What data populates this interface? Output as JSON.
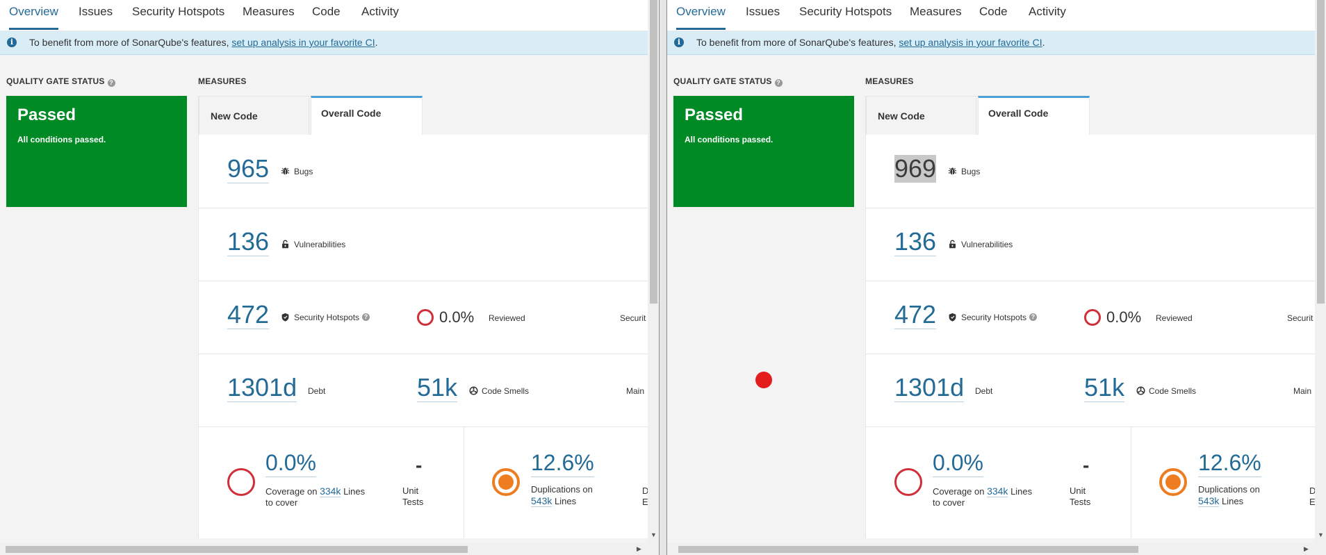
{
  "panes": [
    {
      "nav": [
        "Overview",
        "Issues",
        "Security Hotspots",
        "Measures",
        "Code",
        "Activity"
      ],
      "banner": {
        "prefix": "To benefit from more of SonarQube's features,",
        "link": "set up analysis in your favorite CI",
        "suffix": "."
      },
      "gate": {
        "title": "QUALITY GATE STATUS",
        "status": "Passed",
        "sub": "All conditions passed."
      },
      "measures": {
        "title": "MEASURES",
        "tabs": [
          "New Code",
          "Overall Code"
        ],
        "bugs": {
          "value": "965",
          "label": "Bugs"
        },
        "vulnerabilities": {
          "value": "136",
          "label": "Vulnerabilities"
        },
        "hotspots": {
          "value": "472",
          "label": "Security Hotspots",
          "reviewed_pct": "0.0%",
          "reviewed_label": "Reviewed",
          "edge": "Securit"
        },
        "debt": {
          "value": "1301d",
          "label": "Debt",
          "smells": "51k",
          "smells_label": "Code Smells",
          "edge": "Main"
        },
        "coverage": {
          "value": "0.0%",
          "label_a": "Coverage on",
          "lines": "334k",
          "label_b": "Lines",
          "label_c": "to cover",
          "unit_dash": "-",
          "unit_a": "Unit",
          "unit_b": "Tests"
        },
        "duplications": {
          "value": "12.6%",
          "label_a": "Duplications on",
          "lines": "543k",
          "label_b": "Lines",
          "edge_a": "D",
          "edge_b": "E"
        }
      }
    },
    {
      "nav": [
        "Overview",
        "Issues",
        "Security Hotspots",
        "Measures",
        "Code",
        "Activity"
      ],
      "banner": {
        "prefix": "To benefit from more of SonarQube's features,",
        "link": "set up analysis in your favorite CI",
        "suffix": "."
      },
      "gate": {
        "title": "QUALITY GATE STATUS",
        "status": "Passed",
        "sub": "All conditions passed."
      },
      "measures": {
        "title": "MEASURES",
        "tabs": [
          "New Code",
          "Overall Code"
        ],
        "bugs": {
          "value": "969",
          "label": "Bugs"
        },
        "vulnerabilities": {
          "value": "136",
          "label": "Vulnerabilities"
        },
        "hotspots": {
          "value": "472",
          "label": "Security Hotspots",
          "reviewed_pct": "0.0%",
          "reviewed_label": "Reviewed",
          "edge": "Securit"
        },
        "debt": {
          "value": "1301d",
          "label": "Debt",
          "smells": "51k",
          "smells_label": "Code Smells",
          "edge": "Main"
        },
        "coverage": {
          "value": "0.0%",
          "label_a": "Coverage on",
          "lines": "334k",
          "label_b": "Lines",
          "label_c": "to cover",
          "unit_dash": "-",
          "unit_a": "Unit",
          "unit_b": "Tests"
        },
        "duplications": {
          "value": "12.6%",
          "label_a": "Duplications on",
          "lines": "543k",
          "label_b": "Lines",
          "edge_a": "D",
          "edge_b": "E"
        }
      }
    }
  ],
  "colors": {
    "gate_passed": "#008a25",
    "link": "#236a97",
    "banner_bg": "#d9edf7",
    "rating_red": "#d02f3a",
    "rating_orange": "#ed7d20"
  },
  "icons": [
    "info-icon",
    "help-icon",
    "bug-icon",
    "lock-icon",
    "shield-icon",
    "code-smell-icon"
  ]
}
